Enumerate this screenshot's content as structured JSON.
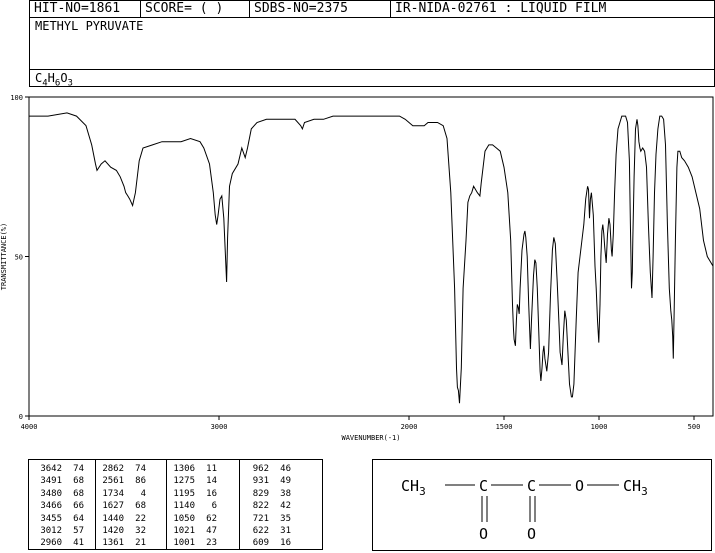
{
  "header": {
    "hit_no": "HIT-NO=1861",
    "score": "SCORE=  (   )",
    "sdbs_no": "SDBS-NO=2375",
    "ir_code": "IR-NIDA-02761 : LIQUID FILM"
  },
  "compound": {
    "name": "METHYL PYRUVATE",
    "formula_parts": [
      {
        "t": "C",
        "sub": false
      },
      {
        "t": "4",
        "sub": true
      },
      {
        "t": "H",
        "sub": false
      },
      {
        "t": "6",
        "sub": true
      },
      {
        "t": "O",
        "sub": false
      },
      {
        "t": "3",
        "sub": true
      }
    ]
  },
  "chart_data": {
    "type": "line",
    "xlabel": "WAVENUMBER(-1)",
    "ylabel": "TRANSMITTANCE(%)",
    "xlim": [
      4000,
      400
    ],
    "ylim": [
      0,
      100
    ],
    "x_ticks": [
      4000,
      3000,
      2000,
      1500,
      1000,
      500
    ],
    "y_ticks": [
      0,
      50,
      100
    ],
    "grid": false,
    "series": [
      {
        "points": [
          [
            4000,
            94
          ],
          [
            3900,
            94
          ],
          [
            3800,
            95
          ],
          [
            3750,
            94
          ],
          [
            3700,
            91
          ],
          [
            3670,
            85
          ],
          [
            3650,
            79
          ],
          [
            3642,
            77
          ],
          [
            3620,
            79
          ],
          [
            3600,
            80
          ],
          [
            3570,
            78
          ],
          [
            3540,
            77
          ],
          [
            3520,
            75
          ],
          [
            3500,
            72
          ],
          [
            3491,
            70
          ],
          [
            3480,
            69
          ],
          [
            3470,
            68
          ],
          [
            3455,
            66
          ],
          [
            3440,
            70
          ],
          [
            3420,
            80
          ],
          [
            3400,
            84
          ],
          [
            3350,
            85
          ],
          [
            3300,
            86
          ],
          [
            3250,
            86
          ],
          [
            3200,
            86
          ],
          [
            3150,
            87
          ],
          [
            3100,
            86
          ],
          [
            3080,
            84
          ],
          [
            3050,
            79
          ],
          [
            3030,
            70
          ],
          [
            3020,
            63
          ],
          [
            3012,
            60
          ],
          [
            3005,
            63
          ],
          [
            2995,
            68
          ],
          [
            2985,
            69
          ],
          [
            2975,
            62
          ],
          [
            2960,
            42
          ],
          [
            2955,
            56
          ],
          [
            2945,
            72
          ],
          [
            2930,
            76
          ],
          [
            2900,
            79
          ],
          [
            2880,
            84
          ],
          [
            2862,
            81
          ],
          [
            2850,
            84
          ],
          [
            2830,
            90
          ],
          [
            2800,
            92
          ],
          [
            2750,
            93
          ],
          [
            2700,
            93
          ],
          [
            2650,
            93
          ],
          [
            2600,
            93
          ],
          [
            2570,
            91
          ],
          [
            2561,
            90
          ],
          [
            2550,
            92
          ],
          [
            2500,
            93
          ],
          [
            2450,
            93
          ],
          [
            2400,
            94
          ],
          [
            2350,
            94
          ],
          [
            2300,
            94
          ],
          [
            2250,
            94
          ],
          [
            2200,
            94
          ],
          [
            2100,
            94
          ],
          [
            2050,
            94
          ],
          [
            2020,
            93
          ],
          [
            2000,
            92
          ],
          [
            1980,
            91
          ],
          [
            1950,
            91
          ],
          [
            1920,
            91
          ],
          [
            1900,
            92
          ],
          [
            1870,
            92
          ],
          [
            1850,
            92
          ],
          [
            1820,
            91
          ],
          [
            1800,
            87
          ],
          [
            1780,
            70
          ],
          [
            1760,
            40
          ],
          [
            1750,
            15
          ],
          [
            1745,
            9
          ],
          [
            1740,
            8
          ],
          [
            1734,
            4
          ],
          [
            1725,
            15
          ],
          [
            1715,
            40
          ],
          [
            1700,
            55
          ],
          [
            1690,
            67
          ],
          [
            1680,
            69
          ],
          [
            1670,
            70
          ],
          [
            1660,
            72
          ],
          [
            1650,
            71
          ],
          [
            1640,
            70
          ],
          [
            1627,
            69
          ],
          [
            1620,
            73
          ],
          [
            1610,
            78
          ],
          [
            1600,
            83
          ],
          [
            1580,
            85
          ],
          [
            1560,
            85
          ],
          [
            1540,
            84
          ],
          [
            1520,
            83
          ],
          [
            1500,
            78
          ],
          [
            1480,
            70
          ],
          [
            1465,
            55
          ],
          [
            1455,
            35
          ],
          [
            1450,
            27
          ],
          [
            1447,
            24
          ],
          [
            1440,
            22
          ],
          [
            1435,
            30
          ],
          [
            1430,
            35
          ],
          [
            1425,
            34
          ],
          [
            1420,
            32
          ],
          [
            1415,
            40
          ],
          [
            1405,
            52
          ],
          [
            1395,
            57
          ],
          [
            1390,
            58
          ],
          [
            1385,
            56
          ],
          [
            1378,
            50
          ],
          [
            1370,
            35
          ],
          [
            1361,
            21
          ],
          [
            1355,
            30
          ],
          [
            1345,
            44
          ],
          [
            1338,
            49
          ],
          [
            1332,
            48
          ],
          [
            1325,
            40
          ],
          [
            1318,
            28
          ],
          [
            1310,
            14
          ],
          [
            1306,
            11
          ],
          [
            1300,
            15
          ],
          [
            1295,
            20
          ],
          [
            1290,
            22
          ],
          [
            1285,
            18
          ],
          [
            1275,
            14
          ],
          [
            1265,
            20
          ],
          [
            1255,
            38
          ],
          [
            1245,
            52
          ],
          [
            1238,
            56
          ],
          [
            1230,
            54
          ],
          [
            1220,
            42
          ],
          [
            1210,
            28
          ],
          [
            1205,
            20
          ],
          [
            1195,
            16
          ],
          [
            1188,
            25
          ],
          [
            1180,
            33
          ],
          [
            1172,
            30
          ],
          [
            1165,
            22
          ],
          [
            1155,
            10
          ],
          [
            1145,
            6
          ],
          [
            1140,
            6
          ],
          [
            1132,
            10
          ],
          [
            1120,
            30
          ],
          [
            1110,
            45
          ],
          [
            1100,
            50
          ],
          [
            1090,
            55
          ],
          [
            1080,
            60
          ],
          [
            1070,
            68
          ],
          [
            1060,
            72
          ],
          [
            1055,
            71
          ],
          [
            1050,
            62
          ],
          [
            1045,
            68
          ],
          [
            1040,
            70
          ],
          [
            1030,
            63
          ],
          [
            1021,
            47
          ],
          [
            1015,
            40
          ],
          [
            1008,
            30
          ],
          [
            1001,
            23
          ],
          [
            995,
            35
          ],
          [
            990,
            50
          ],
          [
            985,
            58
          ],
          [
            980,
            60
          ],
          [
            975,
            57
          ],
          [
            970,
            53
          ],
          [
            962,
            48
          ],
          [
            955,
            57
          ],
          [
            948,
            62
          ],
          [
            942,
            60
          ],
          [
            935,
            52
          ],
          [
            931,
            50
          ],
          [
            925,
            57
          ],
          [
            918,
            70
          ],
          [
            910,
            82
          ],
          [
            900,
            90
          ],
          [
            890,
            92
          ],
          [
            880,
            94
          ],
          [
            870,
            94
          ],
          [
            860,
            94
          ],
          [
            850,
            92
          ],
          [
            840,
            80
          ],
          [
            835,
            60
          ],
          [
            829,
            40
          ],
          [
            825,
            45
          ],
          [
            822,
            55
          ],
          [
            815,
            75
          ],
          [
            808,
            90
          ],
          [
            800,
            93
          ],
          [
            795,
            91
          ],
          [
            790,
            86
          ],
          [
            785,
            84
          ],
          [
            780,
            83
          ],
          [
            770,
            84
          ],
          [
            760,
            83
          ],
          [
            750,
            78
          ],
          [
            740,
            60
          ],
          [
            730,
            45
          ],
          [
            721,
            37
          ],
          [
            715,
            50
          ],
          [
            708,
            70
          ],
          [
            700,
            82
          ],
          [
            690,
            90
          ],
          [
            680,
            94
          ],
          [
            670,
            94
          ],
          [
            660,
            93
          ],
          [
            650,
            85
          ],
          [
            640,
            60
          ],
          [
            630,
            40
          ],
          [
            622,
            33
          ],
          [
            617,
            30
          ],
          [
            612,
            25
          ],
          [
            609,
            18
          ],
          [
            605,
            30
          ],
          [
            598,
            55
          ],
          [
            590,
            78
          ],
          [
            585,
            83
          ],
          [
            575,
            83
          ],
          [
            565,
            81
          ],
          [
            550,
            80
          ],
          [
            530,
            78
          ],
          [
            510,
            75
          ],
          [
            490,
            70
          ],
          [
            470,
            65
          ],
          [
            450,
            55
          ],
          [
            430,
            50
          ],
          [
            410,
            48
          ],
          [
            400,
            47
          ]
        ]
      }
    ]
  },
  "peaks": {
    "columns": [
      {
        "rows": [
          [
            "3642",
            "74"
          ],
          [
            "3491",
            "68"
          ],
          [
            "3480",
            "68"
          ],
          [
            "3466",
            "66"
          ],
          [
            "3455",
            "64"
          ],
          [
            "3012",
            "57"
          ],
          [
            "2960",
            "41"
          ]
        ]
      },
      {
        "rows": [
          [
            "2862",
            "74"
          ],
          [
            "2561",
            "86"
          ],
          [
            "1734",
            "4"
          ],
          [
            "1627",
            "68"
          ],
          [
            "1440",
            "22"
          ],
          [
            "1420",
            "32"
          ],
          [
            "1361",
            "21"
          ]
        ]
      },
      {
        "rows": [
          [
            "1306",
            "11"
          ],
          [
            "1275",
            "14"
          ],
          [
            "1195",
            "16"
          ],
          [
            "1140",
            "6"
          ],
          [
            "1050",
            "62"
          ],
          [
            "1021",
            "47"
          ],
          [
            "1001",
            "23"
          ]
        ]
      },
      {
        "rows": [
          [
            "962",
            "46"
          ],
          [
            "931",
            "49"
          ],
          [
            "829",
            "38"
          ],
          [
            "822",
            "42"
          ],
          [
            "721",
            "35"
          ],
          [
            "622",
            "31"
          ],
          [
            "609",
            "16"
          ]
        ]
      }
    ]
  },
  "structure": {
    "groups": [
      "CH3",
      "C",
      "C",
      "O",
      "CH3"
    ],
    "carbonyl_oxygens": [
      "O",
      "O"
    ]
  }
}
